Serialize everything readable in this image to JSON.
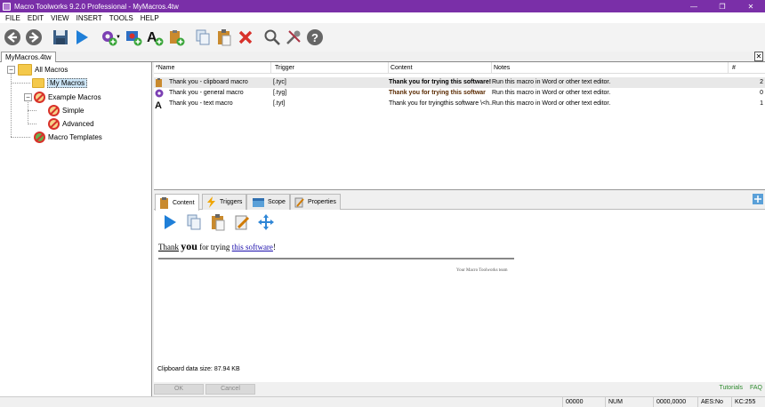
{
  "window": {
    "title": "Macro Toolworks 9.2.0 Professional - MyMacros.4tw",
    "minimize": "—",
    "maximize": "❐",
    "close": "✕"
  },
  "menu": [
    "FILE",
    "EDIT",
    "VIEW",
    "INSERT",
    "TOOLS",
    "HELP"
  ],
  "doc_tab": {
    "label": "MyMacros.4tw",
    "close": "✕"
  },
  "tree": {
    "root": "All Macros",
    "my_macros": "My Macros",
    "example_macros": "Example Macros",
    "simple": "Simple",
    "advanced": "Advanced",
    "templates": "Macro Templates"
  },
  "list": {
    "columns": [
      "*Name",
      "Trigger",
      "Content",
      "Notes",
      "#"
    ],
    "rows": [
      {
        "name": "Thank you - clipboard macro",
        "trigger": "[.tyc]",
        "content": "Thank you for trying this software! _",
        "notes": "Run this macro in Word or other text editor.",
        "count": "2"
      },
      {
        "name": "Thank you - general macro",
        "trigger": "[.tyg]",
        "content": "Thank you for trying this softwar",
        "notes": "Run this macro in Word or other text editor.",
        "count": "0"
      },
      {
        "name": "Thank you - text macro",
        "trigger": "[.tyt]",
        "content": "Thank you for tryingthis software \\<h...",
        "notes": "Run this macro in Word or other text editor.",
        "count": "1"
      }
    ]
  },
  "detail": {
    "tabs": [
      "Content",
      "Triggers",
      "Scope",
      "Properties"
    ],
    "content_parts": {
      "w1": "Thank",
      "w2": "you",
      "w3": " for trying ",
      "link": "this software",
      "end": "!"
    },
    "signature": "Your Macro Toolworks team",
    "clipboard_size": "Clipboard data size: 87.94 KB"
  },
  "buttons": {
    "ok": "OK",
    "cancel": "Cancel"
  },
  "links": {
    "tutorials": "Tutorials",
    "faq": "FAQ"
  },
  "status": {
    "a": "00000",
    "num": "NUM",
    "b": "0000,0000",
    "aes": "AES:No",
    "kc": "KC:255"
  },
  "colors": {
    "titlebar": "#7a2fa8",
    "selection": "#cde6f7",
    "links": "#2e8b2e"
  }
}
